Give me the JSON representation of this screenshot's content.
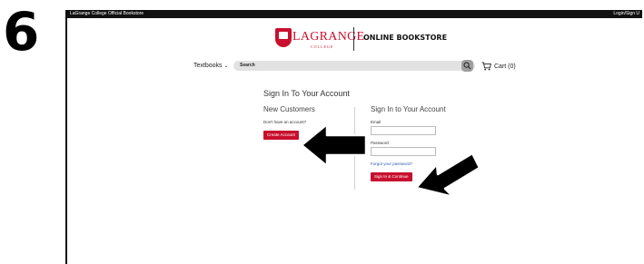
{
  "step_number": "6",
  "topbar": {
    "left_text": "LaGrange College Official Bookstore",
    "right_text": "Login/Sign U"
  },
  "logo": {
    "wordmark": "LAGRANGE",
    "sub": "COLLEGE",
    "tagline": "ONLINE BOOKSTORE"
  },
  "nav": {
    "textbooks_label": "Textbooks",
    "search_placeholder": "Search",
    "cart_label": "Cart (0)"
  },
  "page": {
    "title": "Sign In To Your Account",
    "new_customers": {
      "heading": "New Customers",
      "prompt": "Don't have an account?",
      "button": "Create Account"
    },
    "signin": {
      "heading": "Sign In to Your Account",
      "email_label": "Email",
      "email_value": "",
      "password_label": "Password",
      "password_value": "",
      "forgot_link": "Forgot your password?",
      "button": "Sign In & Continue"
    }
  },
  "colors": {
    "brand_red": "#c8102e",
    "arrow": "#000000"
  },
  "icons": [
    "search-icon",
    "cart-icon",
    "chevron-down-icon",
    "arrow-icon"
  ]
}
